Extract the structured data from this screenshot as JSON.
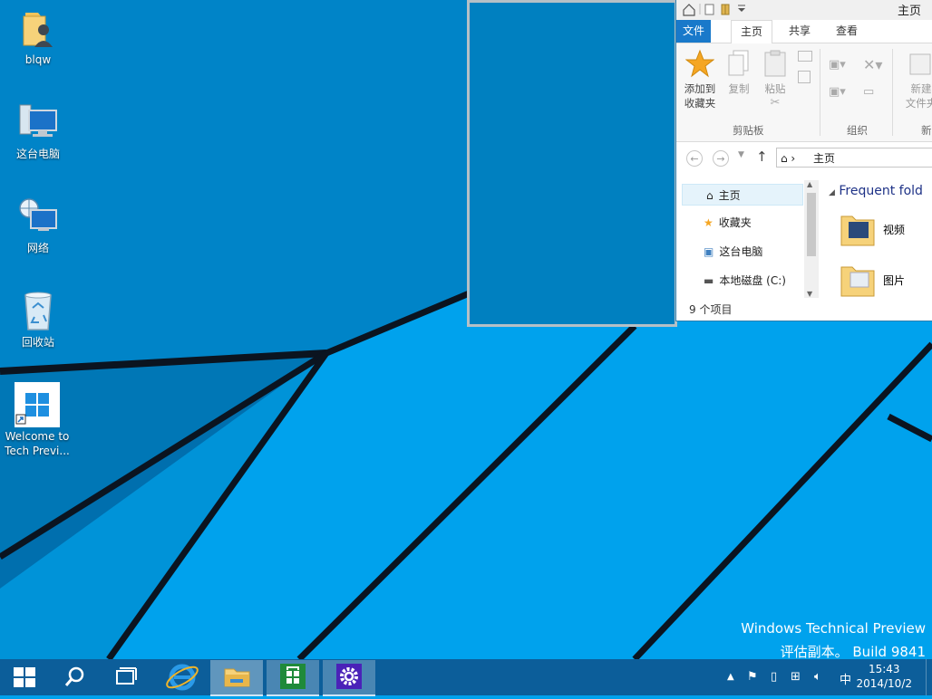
{
  "desktop": {
    "icons": [
      {
        "label": "blqw"
      },
      {
        "label": "这台电脑"
      },
      {
        "label": "网络"
      },
      {
        "label": "回收站"
      },
      {
        "label1": "Welcome to",
        "label2": "Tech Previ..."
      }
    ],
    "watermark": {
      "line1": "Windows Technical Preview",
      "line2": "评估副本。 Build 9841"
    }
  },
  "explorer": {
    "title": "主页",
    "tabs": [
      "文件",
      "主页",
      "共享",
      "查看"
    ],
    "ribbon": {
      "pin_label1": "添加到",
      "pin_label2": "收藏夹",
      "copy_label": "复制",
      "paste_label": "粘贴",
      "group_clipboard": "剪贴板",
      "group_organize": "组织",
      "group_new_partial": "新",
      "new_folder_label1": "新建",
      "new_folder_label2": "文件夹"
    },
    "address": {
      "path": "主页"
    },
    "nav_items": [
      "主页",
      "收藏夹",
      "这台电脑",
      "本地磁盘 (C:)"
    ],
    "content": {
      "section_title": "Frequent fold",
      "folders": [
        "视频",
        "图片"
      ]
    },
    "status": "9 个项目"
  },
  "taskbar": {
    "clock_time": "15:43",
    "clock_date": "2014/10/2",
    "ime": "中"
  },
  "colors": {
    "wallpaper": "#00a2ed",
    "wallpaper_dark": "#0080c0",
    "taskbar": "#0c5e9a",
    "accent": "#1979ca"
  }
}
